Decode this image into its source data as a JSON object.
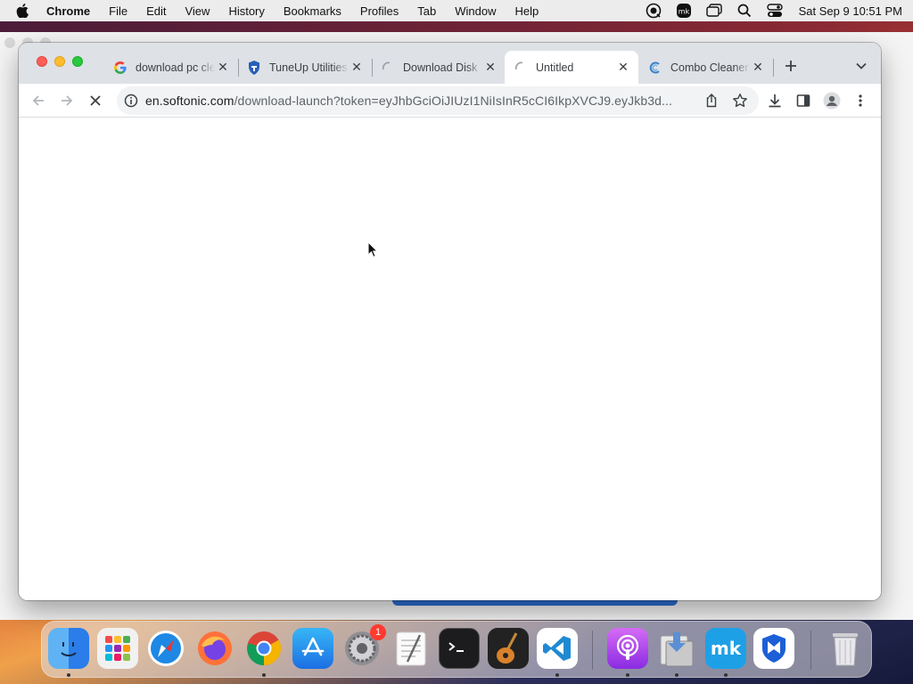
{
  "menubar": {
    "app_name": "Chrome",
    "menus": [
      "File",
      "Edit",
      "View",
      "History",
      "Bookmarks",
      "Profiles",
      "Tab",
      "Window",
      "Help"
    ],
    "clock": "Sat Sep 9  10:51 PM"
  },
  "browser": {
    "tabs": [
      {
        "title": "download pc cleaner",
        "icon": "google-icon",
        "active": false
      },
      {
        "title": "TuneUp Utilities",
        "icon": "shield-icon",
        "active": false
      },
      {
        "title": "Download Disk",
        "icon": "loading-icon",
        "active": false
      },
      {
        "title": "Untitled",
        "icon": "loading-icon",
        "active": true
      },
      {
        "title": "Combo Cleaner",
        "icon": "combo-cleaner-icon",
        "active": false
      }
    ],
    "url_host": "en.softonic.com",
    "url_path": "/download-launch?token=eyJhbGciOiJIUzI1NiIsInR5cCI6IkpXVCJ9.eyJkb3d..."
  },
  "dock": {
    "items": [
      "Finder",
      "Launchpad",
      "Safari",
      "Firefox",
      "Chrome",
      "App Store",
      "System Preferences",
      "TextEdit",
      "Terminal",
      "GarageBand",
      "Visual Studio Code",
      "Podcasts",
      "Downloads",
      "Mackeeper",
      "Malwarebytes",
      "Trash"
    ],
    "settings_badge": "1"
  },
  "colors": {
    "accent": "#1a73e8",
    "tabstrip": "#dee1e6",
    "close": "#ff5f57",
    "minimize": "#febc2e",
    "zoom": "#28c840"
  }
}
